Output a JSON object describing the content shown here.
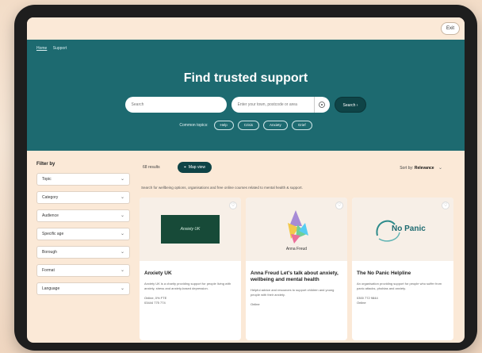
{
  "topbar": {
    "button_label": "Exit"
  },
  "hero": {
    "breadcrumb": [
      "Home",
      "Support"
    ],
    "title": "Find trusted support",
    "search_placeholder": "Search",
    "location_placeholder": "Enter your town, postcode or area",
    "search_button": "Search",
    "topics_label": "Common topics:",
    "topics": [
      "Help",
      "Crisis",
      "Anxiety",
      "Grief"
    ]
  },
  "filters": {
    "title": "Filter by",
    "items": [
      "Topic",
      "Category",
      "Audience",
      "Specific age",
      "Borough",
      "Format",
      "Language"
    ]
  },
  "results": {
    "count_label": "68 results",
    "map_button": "Map view",
    "sort_label": "Sort by:",
    "sort_value": "Relevance",
    "notice": "Search for wellbeing options, organisations and free online courses related to mental health & support."
  },
  "cards": [
    {
      "logo_text": "Anxiety UK",
      "title": "Anxiety UK",
      "desc": "Anxiety UK is a charity providing support for people living with anxiety, stress and anxiety-based depression.",
      "meta": [
        "Online, 0% FTE",
        "03444 775 774"
      ]
    },
    {
      "logo_text": "Anna Freud",
      "title": "Anna Freud Let's talk about anxiety, wellbeing and mental health",
      "desc": "Helpful advice and resources to support children and young people with their anxiety.",
      "meta": [
        "Online"
      ]
    },
    {
      "logo_text": "No Panic",
      "title": "The No Panic Helpline",
      "desc": "An organisation providing support for people who suffer from panic attacks, phobias and anxiety.",
      "meta": [
        "0300 772 9844",
        "Online"
      ]
    }
  ],
  "colors": {
    "hero": "#1d6a70",
    "accent": "#0f4447",
    "page_bg": "#fbe9d7"
  }
}
